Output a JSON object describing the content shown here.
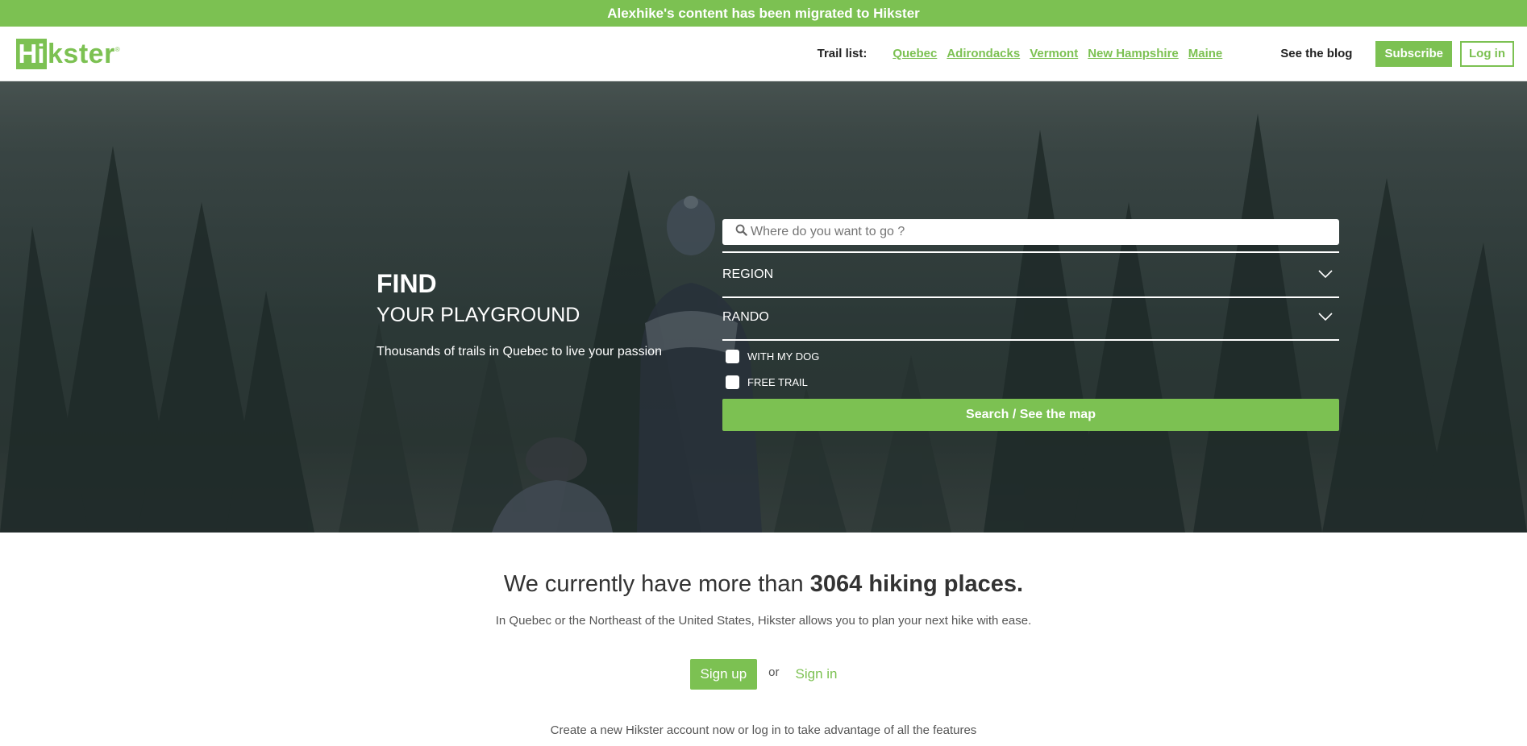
{
  "banner": {
    "text": "Alexhike's content has been migrated to Hikster"
  },
  "logo": {
    "box_text": "Hi",
    "rest_text": "kster",
    "reg_mark": "®"
  },
  "nav": {
    "trail_label": "Trail list:",
    "trail_links": [
      "Quebec",
      "Adirondacks",
      "Vermont",
      "New Hampshire",
      "Maine"
    ],
    "blog": "See the blog",
    "subscribe": "Subscribe",
    "login": "Log in"
  },
  "hero": {
    "find": "FIND",
    "playground": "YOUR PLAYGROUND",
    "tagline": "Thousands of trails in Quebec to live your passion"
  },
  "search": {
    "placeholder": "Where do you want to go ?",
    "icon": "search-icon",
    "region_label": "REGION",
    "activity_label": "RANDO",
    "dropdown_icon": "chevron-down-icon",
    "checkbox_dog": "WITH MY DOG",
    "checkbox_free": "FREE TRAIL",
    "button": "Search / See the map"
  },
  "content": {
    "headline_prefix": "We currently have more than ",
    "headline_bold": "3064 hiking places.",
    "description": "In Quebec or the Northeast of the United States, Hikster allows you to plan your next hike with ease.",
    "signup": "Sign up",
    "or": "or",
    "signin": "Sign in",
    "create_text": "Create a new Hikster account now or log in to take advantage of all the features"
  },
  "colors": {
    "brand_green": "#7cc152",
    "hero_dark": "#2f3c3b"
  }
}
